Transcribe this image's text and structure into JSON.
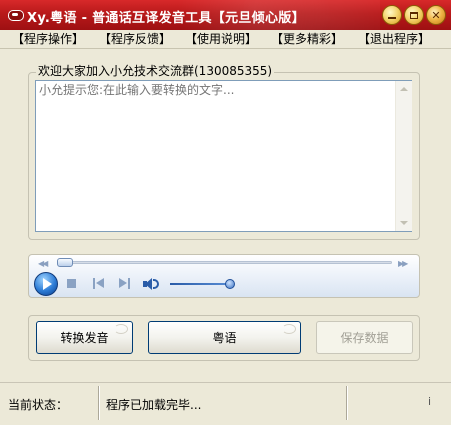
{
  "window": {
    "title": "Xy.粤语 - 普通话互译发音工具【元旦倾心版】",
    "minimize_symbol": "",
    "close_symbol": "✕"
  },
  "menu": [
    {
      "label": "【程序操作】"
    },
    {
      "label": "【程序反馈】"
    },
    {
      "label": "【使用说明】"
    },
    {
      "label": "【更多精彩】"
    },
    {
      "label": "【退出程序】"
    }
  ],
  "input_group": {
    "legend": "欢迎大家加入小允技术交流群(130085355)",
    "placeholder": "小允提示您:在此输入要转换的文字...",
    "value": ""
  },
  "player": {
    "seek_left_arrows": "◀◀",
    "seek_right_arrows": "▶▶",
    "seek_progress": 0.0,
    "volume_level": 0.85
  },
  "buttons": {
    "convert": "转换发音",
    "cantonese": "粤语",
    "save": "保存数据"
  },
  "status": {
    "label": "当前状态：",
    "value": "程序已加载完毕...",
    "grip": "ⅰ"
  },
  "colors": {
    "titlebar": "#c01c1e",
    "window_bg": "#ece9d8",
    "button_border": "#003c74",
    "disabled_text": "#a19f95"
  },
  "icons": {
    "app": "tape-icon",
    "minimize": "minimize-icon",
    "maximize": "maximize-icon",
    "close": "close-icon",
    "play": "play-icon",
    "stop": "stop-icon",
    "previous": "previous-icon",
    "next": "next-icon",
    "volume": "volume-icon"
  }
}
